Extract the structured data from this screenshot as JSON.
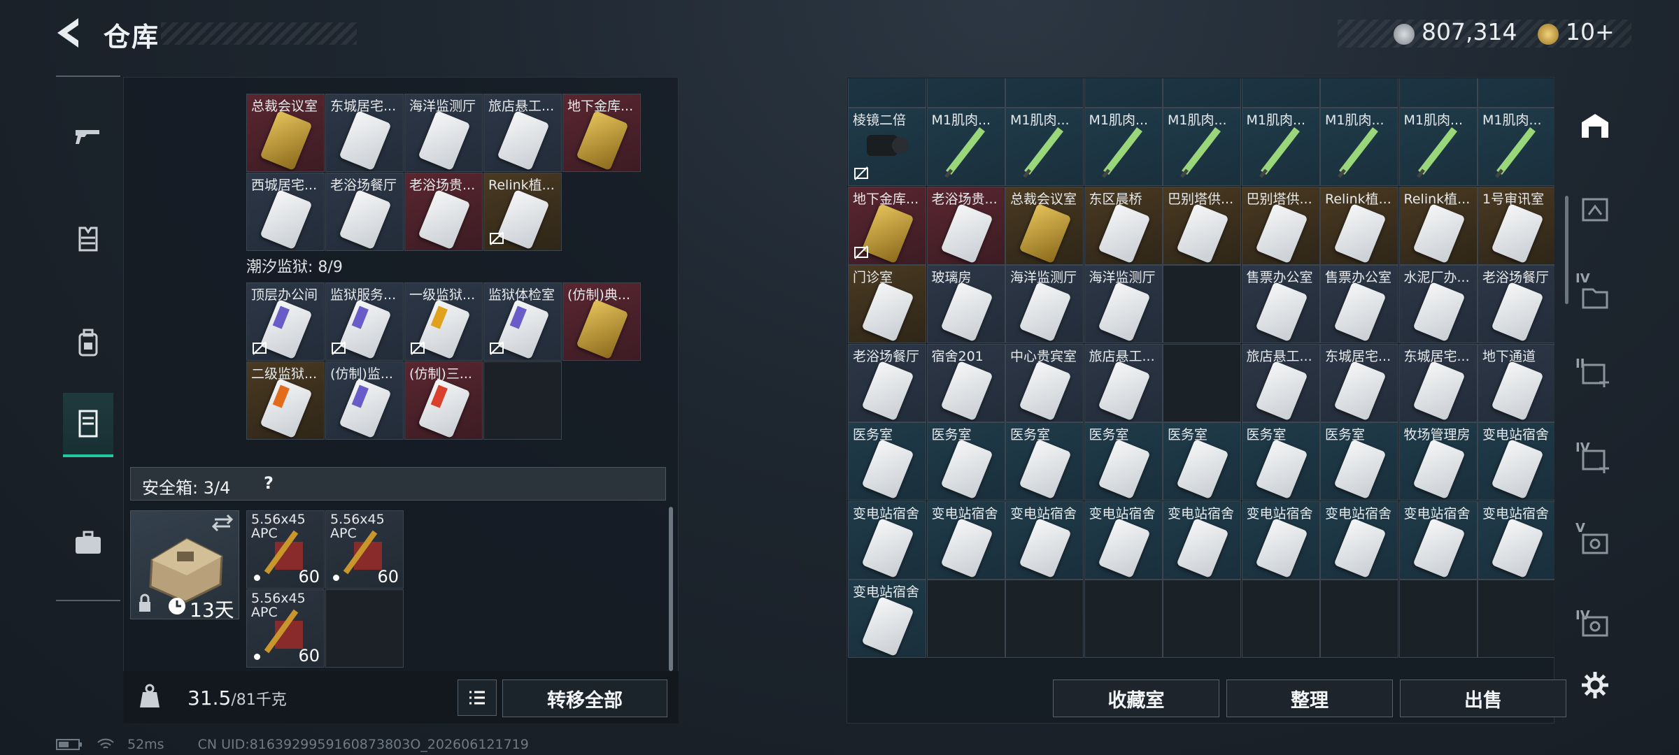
{
  "header": {
    "title": "仓库"
  },
  "currency": {
    "silver": "807,314",
    "gold": "10+"
  },
  "sidenav": [
    {
      "name": "weapon-tab",
      "icon": "gun-icon"
    },
    {
      "name": "armor-tab",
      "icon": "vest-icon"
    },
    {
      "name": "backpack-tab",
      "icon": "backpack-icon"
    },
    {
      "name": "storage-tab",
      "icon": "locker-icon",
      "selected": true
    },
    {
      "name": "case-tab",
      "icon": "briefcase-icon"
    }
  ],
  "left": {
    "group1_row1": [
      "总裁会议室",
      "东城居宅...",
      "海洋监测厅",
      "旅店悬工...",
      "地下金库..."
    ],
    "group1_row2": [
      "西城居宅...",
      "老浴场餐厅",
      "老浴场贵...",
      "Relink植..."
    ],
    "group2_title": "潮汐监狱: 8/9",
    "group2_row1": [
      "顶层办公间",
      "监狱服务...",
      "一级监狱...",
      "监狱体检室",
      "(仿制)典..."
    ],
    "group2_row2": [
      "二级监狱...",
      "(仿制)监...",
      "(仿制)三..."
    ],
    "safebox": {
      "label": "安全箱: 3/4",
      "help": "?",
      "days": "13天"
    },
    "ammo": [
      {
        "label": "5.56x45 APC",
        "count": "60"
      },
      {
        "label": "5.56x45 APC",
        "count": "60"
      },
      {
        "label": "5.56x45 APC",
        "count": "60"
      }
    ],
    "weight": {
      "current": "31.5",
      "max": "/81千克"
    },
    "transfer_all": "转移全部"
  },
  "right": {
    "rows": [
      [
        "棱镜二倍",
        "M1肌肉...",
        "M1肌肉...",
        "M1肌肉...",
        "M1肌肉...",
        "M1肌肉...",
        "M1肌肉...",
        "M1肌肉...",
        "M1肌肉..."
      ],
      [
        "地下金库...",
        "老浴场贵...",
        "总裁会议室",
        "东区晨桥",
        "巴别塔供...",
        "巴别塔供...",
        "Relink植...",
        "Relink植...",
        "1号审讯室"
      ],
      [
        "门诊室",
        "玻璃房",
        "海洋监测厅",
        "海洋监测厅",
        "",
        "售票办公室",
        "售票办公室",
        "水泥厂办...",
        "老浴场餐厅"
      ],
      [
        "老浴场餐厅",
        "宿舍201",
        "中心贵宾室",
        "旅店悬工...",
        "",
        "旅店悬工...",
        "东城居宅...",
        "东城居宅...",
        "地下通道"
      ],
      [
        "医务室",
        "医务室",
        "医务室",
        "医务室",
        "医务室",
        "医务室",
        "医务室",
        "牧场管理房",
        "变电站宿舍"
      ],
      [
        "变电站宿舍",
        "变电站宿舍",
        "变电站宿舍",
        "变电站宿舍",
        "变电站宿舍",
        "变电站宿舍",
        "变电站宿舍",
        "变电站宿舍",
        "变电站宿舍"
      ],
      [
        "变电站宿舍",
        "",
        "",
        "",
        "",
        "",
        "",
        "",
        ""
      ]
    ],
    "buttons": {
      "collection": "收藏室",
      "sort": "整理",
      "sell": "出售"
    }
  },
  "rail": {
    "labels": [
      "IV",
      "II",
      "IV",
      "V",
      "IV"
    ]
  },
  "status": {
    "ping": "52ms",
    "uid": "CN UID:8163929959160873803O_202606121719"
  }
}
